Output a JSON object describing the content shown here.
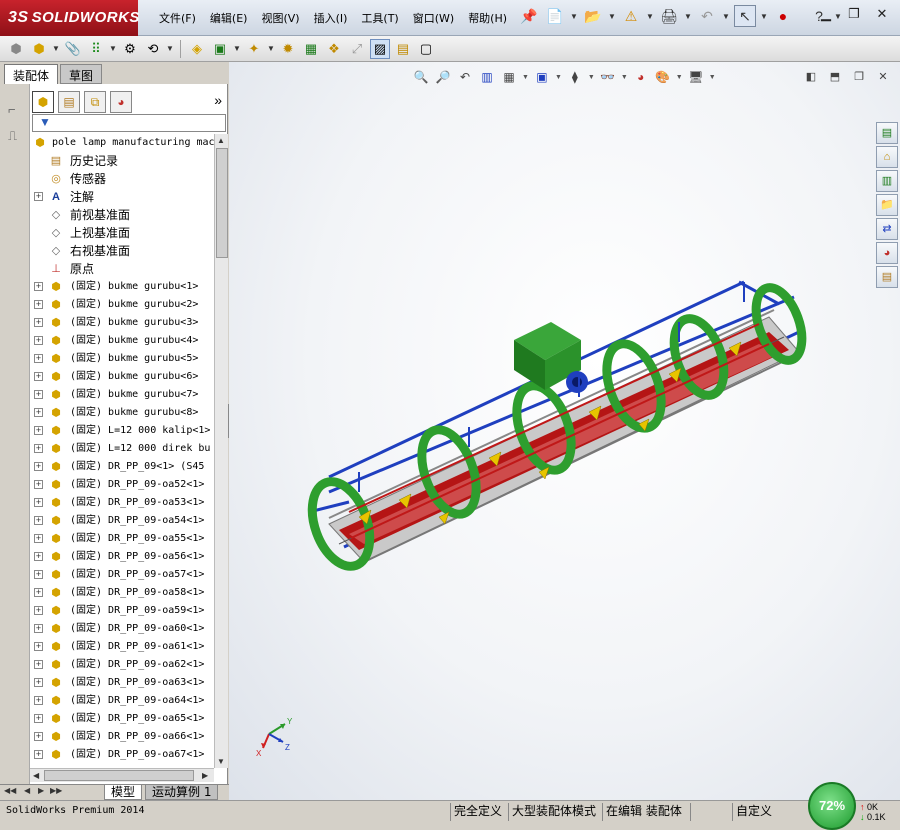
{
  "app": {
    "logo_text": "SOLIDWORKS",
    "logo_prefix": "3S"
  },
  "menubar": {
    "items": [
      "文件(F)",
      "编辑(E)",
      "视图(V)",
      "插入(I)",
      "工具(T)",
      "窗口(W)",
      "帮助(H)"
    ]
  },
  "topbar_icons": [
    "pin-icon",
    "new-doc-icon",
    "open-icon",
    "rebuild-warning-icon",
    "print-icon",
    "undo-icon",
    "select-arrow-icon",
    "traffic-light-icon",
    "help-icon"
  ],
  "window_controls": [
    "minimize",
    "restore",
    "close"
  ],
  "panel_tabs": {
    "assembly": "装配体",
    "sketch": "草图"
  },
  "feature_tree": {
    "root": "pole lamp manufacturing mac",
    "rows": [
      {
        "label": "历史记录",
        "icon": "history-icon",
        "expandable": false,
        "cjk": true
      },
      {
        "label": "传感器",
        "icon": "sensor-icon",
        "expandable": false,
        "cjk": true
      },
      {
        "label": "注解",
        "icon": "annotation-icon",
        "expandable": true,
        "cjk": true
      },
      {
        "label": "前视基准面",
        "icon": "plane-icon",
        "expandable": false,
        "cjk": true
      },
      {
        "label": "上视基准面",
        "icon": "plane-icon",
        "expandable": false,
        "cjk": true
      },
      {
        "label": "右视基准面",
        "icon": "plane-icon",
        "expandable": false,
        "cjk": true
      },
      {
        "label": "原点",
        "icon": "origin-icon",
        "expandable": false,
        "cjk": true
      },
      {
        "label": "(固定) bukme gurubu<1>",
        "icon": "subassembly-icon",
        "expandable": true,
        "cjk": false
      },
      {
        "label": "(固定) bukme gurubu<2>",
        "icon": "subassembly-icon",
        "expandable": true,
        "cjk": false
      },
      {
        "label": "(固定) bukme gurubu<3>",
        "icon": "subassembly-icon",
        "expandable": true,
        "cjk": false
      },
      {
        "label": "(固定) bukme gurubu<4>",
        "icon": "subassembly-icon",
        "expandable": true,
        "cjk": false
      },
      {
        "label": "(固定) bukme gurubu<5>",
        "icon": "subassembly-icon",
        "expandable": true,
        "cjk": false
      },
      {
        "label": "(固定) bukme gurubu<6>",
        "icon": "subassembly-icon",
        "expandable": true,
        "cjk": false
      },
      {
        "label": "(固定) bukme gurubu<7>",
        "icon": "subassembly-icon",
        "expandable": true,
        "cjk": false
      },
      {
        "label": "(固定) bukme gurubu<8>",
        "icon": "subassembly-icon",
        "expandable": true,
        "cjk": false
      },
      {
        "label": "(固定) L=12 000 kalip<1>",
        "icon": "subassembly-icon",
        "expandable": true,
        "cjk": false
      },
      {
        "label": "(固定) L=12 000 direk bu",
        "icon": "subassembly-icon",
        "expandable": true,
        "cjk": false
      },
      {
        "label": "(固定) DR_PP_09<1> (S45",
        "icon": "subassembly-icon",
        "expandable": true,
        "cjk": false
      },
      {
        "label": "(固定) DR_PP_09-oa52<1>",
        "icon": "subassembly-icon",
        "expandable": true,
        "cjk": false
      },
      {
        "label": "(固定) DR_PP_09-oa53<1>",
        "icon": "subassembly-icon",
        "expandable": true,
        "cjk": false
      },
      {
        "label": "(固定) DR_PP_09-oa54<1>",
        "icon": "subassembly-icon",
        "expandable": true,
        "cjk": false
      },
      {
        "label": "(固定) DR_PP_09-oa55<1>",
        "icon": "subassembly-icon",
        "expandable": true,
        "cjk": false
      },
      {
        "label": "(固定) DR_PP_09-oa56<1>",
        "icon": "subassembly-icon",
        "expandable": true,
        "cjk": false
      },
      {
        "label": "(固定) DR_PP_09-oa57<1>",
        "icon": "subassembly-icon",
        "expandable": true,
        "cjk": false
      },
      {
        "label": "(固定) DR_PP_09-oa58<1>",
        "icon": "subassembly-icon",
        "expandable": true,
        "cjk": false
      },
      {
        "label": "(固定) DR_PP_09-oa59<1>",
        "icon": "subassembly-icon",
        "expandable": true,
        "cjk": false
      },
      {
        "label": "(固定) DR_PP_09-oa60<1>",
        "icon": "subassembly-icon",
        "expandable": true,
        "cjk": false
      },
      {
        "label": "(固定) DR_PP_09-oa61<1>",
        "icon": "subassembly-icon",
        "expandable": true,
        "cjk": false
      },
      {
        "label": "(固定) DR_PP_09-oa62<1>",
        "icon": "subassembly-icon",
        "expandable": true,
        "cjk": false
      },
      {
        "label": "(固定) DR_PP_09-oa63<1>",
        "icon": "subassembly-icon",
        "expandable": true,
        "cjk": false
      },
      {
        "label": "(固定) DR_PP_09-oa64<1>",
        "icon": "subassembly-icon",
        "expandable": true,
        "cjk": false
      },
      {
        "label": "(固定) DR_PP_09-oa65<1>",
        "icon": "subassembly-icon",
        "expandable": true,
        "cjk": false
      },
      {
        "label": "(固定) DR_PP_09-oa66<1>",
        "icon": "subassembly-icon",
        "expandable": true,
        "cjk": false
      },
      {
        "label": "(固定) DR_PP_09-oa67<1>",
        "icon": "subassembly-icon",
        "expandable": true,
        "cjk": false
      }
    ]
  },
  "bottom_tabs": {
    "model": "模型",
    "motion": "运动算例 1"
  },
  "statusbar": {
    "product": "SolidWorks Premium 2014",
    "fully_defined": "完全定义",
    "large_assembly": "大型装配体模式",
    "editing": "在编辑 装配体",
    "units": "自定义",
    "gauge": "72%",
    "net_up": "0K",
    "net_down": "0.1K"
  },
  "triad": {
    "x": "X",
    "y": "Y",
    "z": "Z"
  },
  "colors": {
    "frame_green": "#2e9e2e",
    "rail_blue": "#1f3fbf",
    "red_parts": "#c01818",
    "logo_red": "#c8232c",
    "gauge_green": "#1b9a2c"
  }
}
